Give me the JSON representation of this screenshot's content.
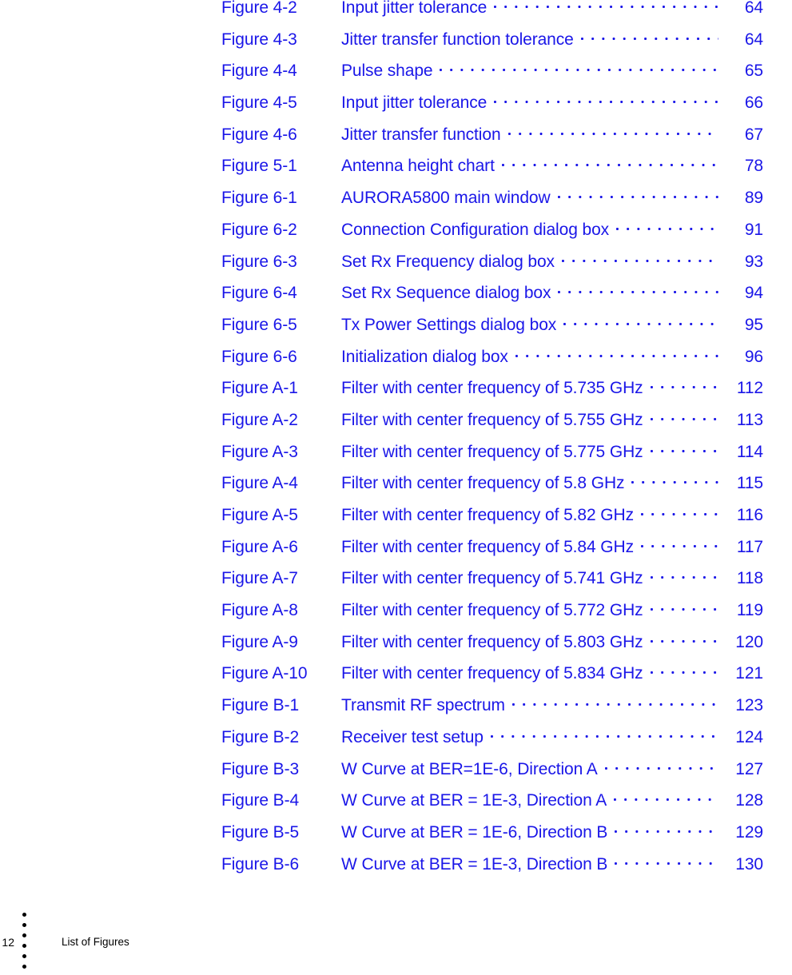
{
  "document": {
    "section_title": "List of Figures",
    "footer_page_number": "12",
    "link_color": "#1a16e8",
    "text_color": "#000000"
  },
  "figure_list": {
    "entries": [
      {
        "label": "Figure 4-2",
        "title": "Input jitter tolerance",
        "page": "64"
      },
      {
        "label": "Figure 4-3",
        "title": "Jitter transfer function tolerance",
        "page": "64"
      },
      {
        "label": "Figure 4-4",
        "title": "Pulse shape",
        "page": "65"
      },
      {
        "label": "Figure 4-5",
        "title": "Input jitter tolerance",
        "page": "66"
      },
      {
        "label": "Figure 4-6",
        "title": "Jitter transfer function",
        "page": "67"
      },
      {
        "label": "Figure 5-1",
        "title": "Antenna height chart",
        "page": "78"
      },
      {
        "label": "Figure 6-1",
        "title": "AURORA5800 main window",
        "page": "89"
      },
      {
        "label": "Figure 6-2",
        "title": "Connection Configuration dialog box",
        "page": "91"
      },
      {
        "label": "Figure 6-3",
        "title": "Set Rx Frequency dialog box",
        "page": "93"
      },
      {
        "label": "Figure 6-4",
        "title": "Set Rx Sequence dialog box",
        "page": "94"
      },
      {
        "label": "Figure 6-5",
        "title": "Tx Power Settings dialog box",
        "page": "95"
      },
      {
        "label": "Figure 6-6",
        "title": "Initialization dialog box",
        "page": "96"
      },
      {
        "label": "Figure A-1",
        "title": "Filter with center frequency of 5.735 GHz",
        "page": "112"
      },
      {
        "label": "Figure A-2",
        "title": "Filter with center frequency of 5.755 GHz",
        "page": "113"
      },
      {
        "label": "Figure A-3",
        "title": "Filter with center frequency of 5.775 GHz",
        "page": "114"
      },
      {
        "label": "Figure A-4",
        "title": "Filter with center frequency of 5.8 GHz",
        "page": "115"
      },
      {
        "label": "Figure A-5",
        "title": "Filter with center frequency of 5.82 GHz",
        "page": "116"
      },
      {
        "label": "Figure A-6",
        "title": "Filter with center frequency of 5.84 GHz",
        "page": "117"
      },
      {
        "label": "Figure A-7",
        "title": "Filter with center frequency of 5.741 GHz",
        "page": "118"
      },
      {
        "label": "Figure A-8",
        "title": "Filter with center frequency of 5.772 GHz",
        "page": "119"
      },
      {
        "label": "Figure A-9",
        "title": "Filter with center frequency of 5.803 GHz",
        "page": "120"
      },
      {
        "label": "Figure A-10",
        "title": "Filter with center frequency of 5.834 GHz",
        "page": "121"
      },
      {
        "label": "Figure B-1",
        "title": "Transmit RF spectrum",
        "page": "123"
      },
      {
        "label": "Figure B-2",
        "title": "Receiver test setup",
        "page": "124"
      },
      {
        "label": "Figure B-3",
        "title": "W Curve at BER=1E-6, Direction A",
        "page": "127"
      },
      {
        "label": "Figure B-4",
        "title": "W Curve at BER = 1E-3, Direction A",
        "page": "128"
      },
      {
        "label": "Figure B-5",
        "title": "W Curve at BER = 1E-6, Direction B",
        "page": "129"
      },
      {
        "label": "Figure B-6",
        "title": "W Curve at BER = 1E-3, Direction B",
        "page": "130"
      }
    ]
  }
}
